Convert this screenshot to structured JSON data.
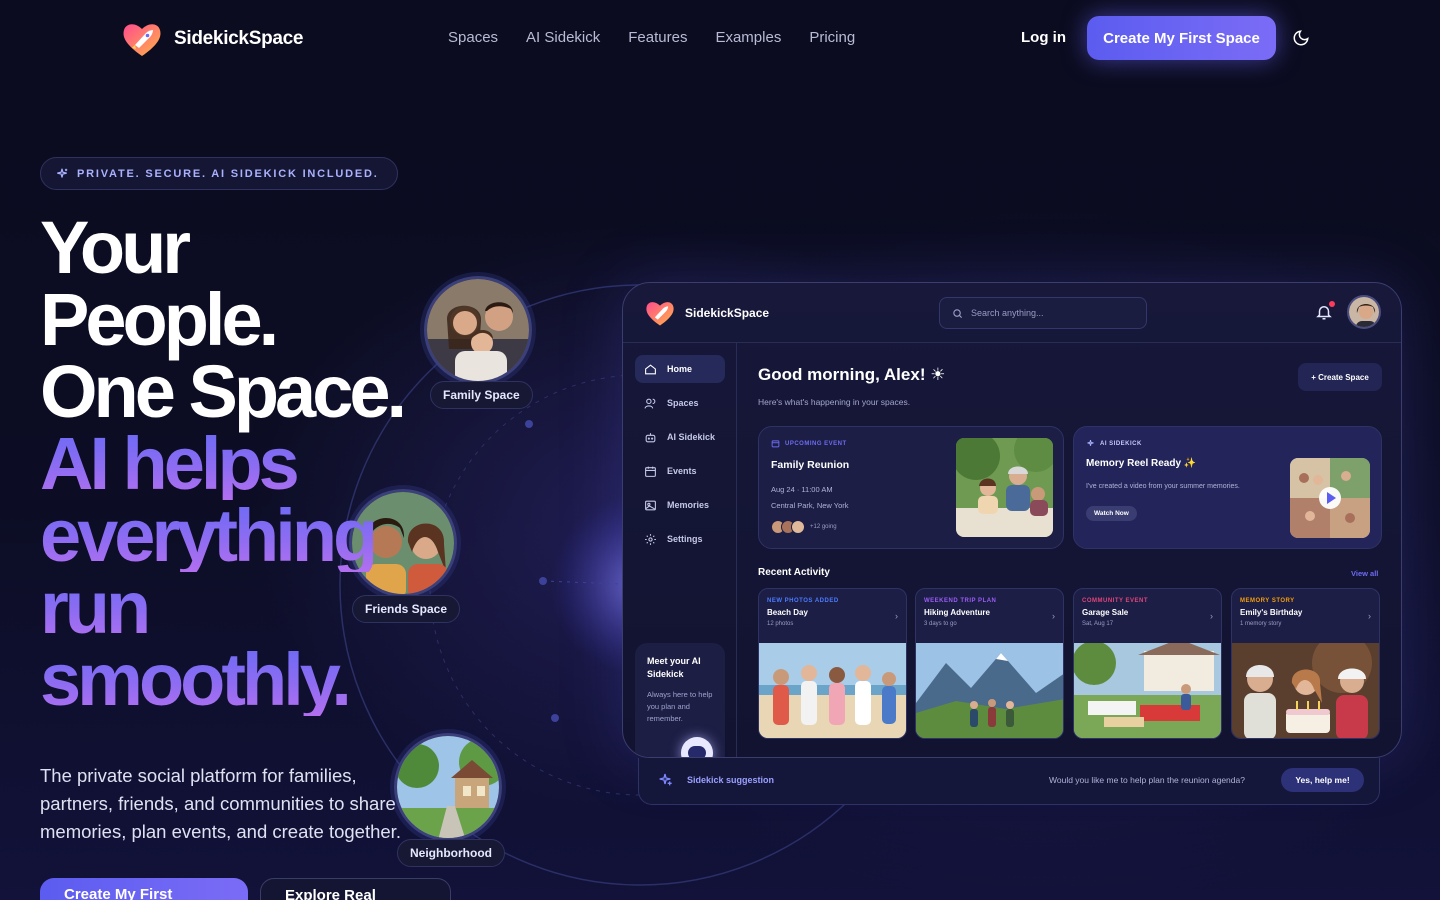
{
  "nav": {
    "brand": "SidekickSpace",
    "links": [
      "Spaces",
      "AI Sidekick",
      "Features",
      "Examples",
      "Pricing"
    ],
    "login": "Log in",
    "cta": "Create My First Space"
  },
  "hero": {
    "badge": "PRIVATE. SECURE. AI SIDEKICK INCLUDED.",
    "title_lines": [
      "Your",
      "People.",
      "One Space."
    ],
    "gradient_lines": [
      "AI helps",
      "everything",
      "run",
      "smoothly."
    ],
    "subtitle": "The private social platform for families, partners, friends, and communities to share memories, plan events, and create together.",
    "primary_button": "Create My First",
    "secondary_button": "Explore Real"
  },
  "orbit": {
    "chips": [
      "Family Space",
      "Friends Space",
      "Neighborhood"
    ]
  },
  "dashboard": {
    "brand": "SidekickSpace",
    "search_placeholder": "Search anything...",
    "sidebar": [
      "Home",
      "Spaces",
      "AI Sidekick",
      "Events",
      "Memories",
      "Settings"
    ],
    "meet_title": "Meet your AI Sidekick",
    "meet_desc": "Always here to help you plan and remember.",
    "greeting": "Good morning, Alex! ☀",
    "greeting_sub": "Here's what's happening in your spaces.",
    "create_space": "+ Create Space",
    "event_card": {
      "tag": "UPCOMING EVENT",
      "title": "Family Reunion",
      "date": "Aug 24 · 11:00 AM",
      "place": "Central Park, New York",
      "going": "+12 going"
    },
    "ai_card": {
      "tag": "AI SIDEKICK",
      "title": "Memory Reel Ready ✨",
      "text": "I've created a video from your summer memories.",
      "button": "Watch Now"
    },
    "recent_title": "Recent Activity",
    "view_all": "View all",
    "tiles": [
      {
        "tag": "NEW PHOTOS ADDED",
        "title": "Beach Day",
        "sub": "12 photos",
        "tag_color": "#4b7bff"
      },
      {
        "tag": "WEEKEND TRIP PLAN",
        "title": "Hiking Adventure",
        "sub": "3 days to go",
        "tag_color": "#9b5cf6"
      },
      {
        "tag": "COMMUNITY EVENT",
        "title": "Garage Sale",
        "sub": "Sat, Aug 17",
        "tag_color": "#e0457b"
      },
      {
        "tag": "MEMORY STORY",
        "title": "Emily's Birthday",
        "sub": "1 memory story",
        "tag_color": "#f59e0b"
      }
    ],
    "suggestion_label": "Sidekick suggestion",
    "suggestion_text": "Would you like me to help plan the reunion agenda?",
    "suggestion_button": "Yes, help me!"
  },
  "colors": {
    "accent": "#5b5cf0",
    "gradient_start": "#6b6af5",
    "gradient_end": "#b36ff0",
    "background": "#0b0c1f"
  }
}
